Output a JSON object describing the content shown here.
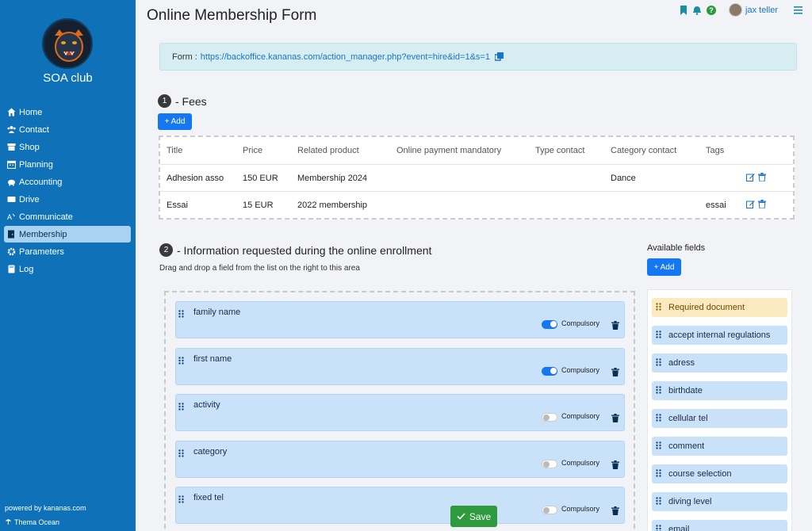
{
  "sidebar": {
    "club_name": "SOA club",
    "items": [
      {
        "label": "Home",
        "icon": "home-icon"
      },
      {
        "label": "Contact",
        "icon": "users-icon"
      },
      {
        "label": "Shop",
        "icon": "shop-icon"
      },
      {
        "label": "Planning",
        "icon": "calendar-icon"
      },
      {
        "label": "Accounting",
        "icon": "piggy-bank-icon"
      },
      {
        "label": "Drive",
        "icon": "drive-icon"
      },
      {
        "label": "Communicate",
        "icon": "broadcast-icon"
      },
      {
        "label": "Membership",
        "icon": "door-icon",
        "active": true
      },
      {
        "label": "Parameters",
        "icon": "gear-icon"
      },
      {
        "label": "Log",
        "icon": "book-icon"
      }
    ],
    "powered_by": "powered by kananas.com",
    "theme": "Thema Ocean"
  },
  "header": {
    "title": "Online Membership Form",
    "username": "jax teller",
    "icons": [
      "bookmark-icon",
      "bell-icon",
      "help-icon",
      "menu-icon"
    ]
  },
  "form_url": {
    "label": "Form :",
    "url": "https://backoffice.kananas.com/action_manager.php?event=hire&id=1&s=1"
  },
  "fees": {
    "number": "1",
    "title": "- Fees",
    "add_label": "+ Add",
    "columns": [
      "Title",
      "Price",
      "Related product",
      "Online payment mandatory",
      "Type contact",
      "Category contact",
      "Tags"
    ],
    "rows": [
      [
        "Adhesion asso",
        "150 EUR",
        "Membership 2024",
        "",
        "",
        "Dance",
        ""
      ],
      [
        "Essai",
        "15 EUR",
        "2022 membership",
        "",
        "",
        "",
        "essai"
      ]
    ]
  },
  "info": {
    "number": "2",
    "title": "- Information requested during the online enrollment",
    "subtitle": "Drag and drop a field from the list on the right to this area",
    "compulsory_label": "Compulsory",
    "fields": [
      {
        "name": "family name",
        "compulsory": true
      },
      {
        "name": "first name",
        "compulsory": true
      },
      {
        "name": "activity",
        "compulsory": false
      },
      {
        "name": "category",
        "compulsory": false
      },
      {
        "name": "fixed tel",
        "compulsory": false
      }
    ]
  },
  "available": {
    "title": "Available fields",
    "add_label": "+ Add",
    "items": [
      {
        "label": "Required document",
        "highlight": true
      },
      {
        "label": "accept internal regulations"
      },
      {
        "label": "adress"
      },
      {
        "label": "birthdate"
      },
      {
        "label": "cellular tel"
      },
      {
        "label": "comment"
      },
      {
        "label": "course selection"
      },
      {
        "label": "diving level"
      },
      {
        "label": "email"
      }
    ]
  },
  "save_label": "Save",
  "colors": {
    "sidebar": "#0f72b8",
    "primary": "#1677f2",
    "save": "#2e9a3e",
    "field": "#c9e2fa",
    "highlight": "#fbe9c0"
  }
}
